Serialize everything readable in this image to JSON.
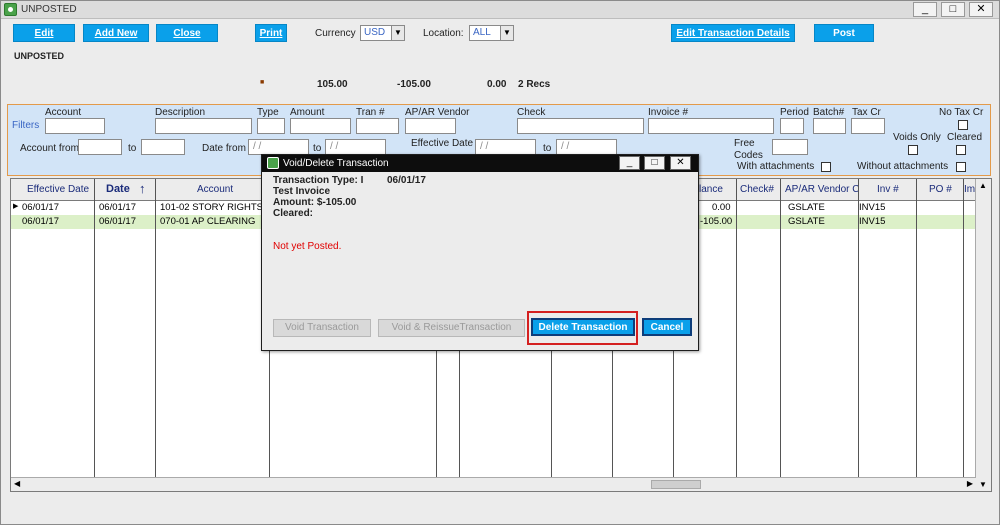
{
  "window": {
    "title": "UNPOSTED",
    "controls": [
      "_",
      "□",
      "✕"
    ]
  },
  "toolbar": {
    "edit": "Edit",
    "add_new": "Add New",
    "close": "Close",
    "print": "Print",
    "currency_label": "Currency",
    "currency_value": "USD",
    "location_label": "Location:",
    "location_value": "ALL",
    "edit_details": "Edit Transaction Details",
    "post": "Post"
  },
  "status": {
    "heading": "UNPOSTED",
    "marker": "■",
    "debit": "105.00",
    "credit": "-105.00",
    "balance": "0.00",
    "records": "2 Recs"
  },
  "filters": {
    "title": "Filters",
    "account": "Account",
    "description": "Description",
    "type": "Type",
    "amount": "Amount",
    "tran": "Tran #",
    "vendor": "AP/AR Vendor",
    "check": "Check",
    "invoice": "Invoice #",
    "period": "Period",
    "batch": "Batch#",
    "tax_cr": "Tax Cr",
    "no_tax_cr": "No Tax Cr",
    "account_from": "Account from",
    "to": "to",
    "date_from": "Date from",
    "date_placeholder": " /  /",
    "effective_date": "Effective Date",
    "free_codes": "Free Codes",
    "voids_only": "Voids Only",
    "cleared": "Cleared",
    "with_attachments": "With attachments",
    "without_attachments": "Without attachments"
  },
  "grid": {
    "headers": [
      "Effective Date",
      "Date",
      "Account",
      "lance",
      "Check#",
      "AP/AR Vendor C",
      "Inv #",
      "PO #",
      "Im"
    ],
    "rows": [
      {
        "eff": "06/01/17",
        "date": "06/01/17",
        "account": "101-02  STORY RIGHTS",
        "balance": "0.00",
        "vendor": "GSLATE",
        "inv": "INV15"
      },
      {
        "eff": "06/01/17",
        "date": "06/01/17",
        "account": "070-01  AP CLEARING",
        "balance": "-105.00",
        "vendor": "GSLATE",
        "inv": "INV15"
      }
    ]
  },
  "dialog": {
    "title": "Void/Delete Transaction",
    "type_line": "Transaction Type: I",
    "date": "06/01/17",
    "description": "Test Invoice",
    "amount": "Amount: $-105.00",
    "cleared": "Cleared:",
    "status": "Not yet Posted.",
    "void": "Void Transaction",
    "void_reissue": "Void & ReissueTransaction",
    "delete": "Delete Transaction",
    "cancel": "Cancel"
  },
  "colors": {
    "button_blue": "#0aa0ea",
    "highlight_red": "#d42020",
    "selected_row": "#dcf0c8",
    "filter_bg": "#d2e4f7"
  }
}
